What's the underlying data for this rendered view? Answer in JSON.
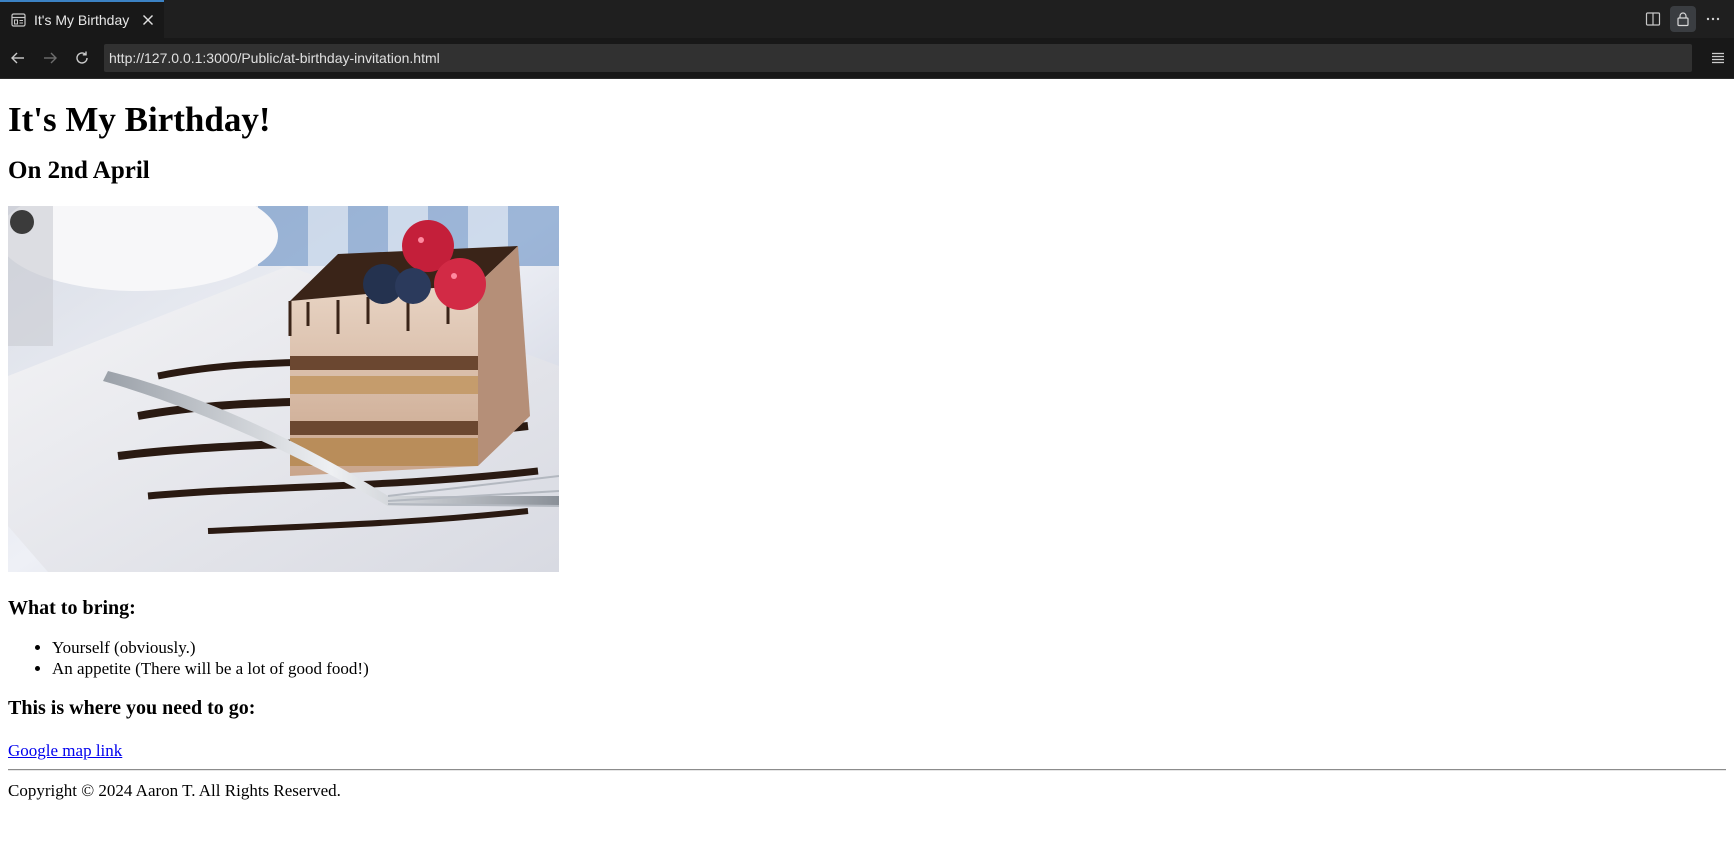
{
  "browser": {
    "tab": {
      "title": "It's My Birthday",
      "icon": "page-preview-icon"
    },
    "address": {
      "url": "http://127.0.0.1:3000/Public/at-birthday-invitation.html"
    },
    "colors": {
      "chrome_bg": "#181818",
      "tab_accent": "#3b82c4",
      "url_bg": "#313131",
      "link": "#0000ee"
    }
  },
  "page": {
    "title": "It's My Birthday!",
    "date": "On 2nd April",
    "image_subject": "slice of layered tiramisu cake with raspberries and blueberries on a plate with a fork",
    "bring_heading": "What to bring:",
    "bring_items": [
      "Yourself (obviously.)",
      "An appetite (There will be a lot of good food!)"
    ],
    "where_heading": "This is where you need to go:",
    "map_link_text": "Google map link",
    "copyright": "Copyright © 2024 Aaron T. All Rights Reserved."
  }
}
